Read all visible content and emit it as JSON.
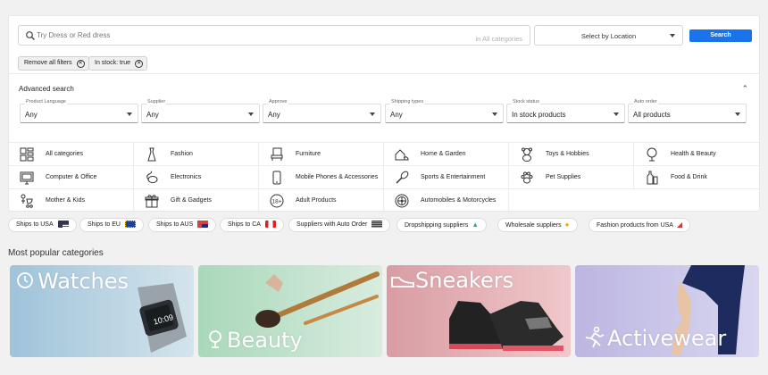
{
  "search": {
    "placeholder": "Try Dress or Red dress",
    "scope": "in All categories",
    "location_placeholder": "Select by Location",
    "button_label": "Search"
  },
  "active_filters": {
    "remove_all_label": "Remove all filters",
    "chips": [
      "In stock: true"
    ]
  },
  "advanced_search": {
    "title": "Advanced search",
    "filters": [
      {
        "label": "Product Language",
        "value": "Any"
      },
      {
        "label": "Supplier",
        "value": "Any"
      },
      {
        "label": "Approve",
        "value": "Any"
      },
      {
        "label": "Shipping types",
        "value": "Any"
      },
      {
        "label": "Stock status",
        "value": "In stock products"
      },
      {
        "label": "Auto order",
        "value": "All products"
      }
    ]
  },
  "categories": [
    {
      "name": "All categories",
      "icon": "grid-icon"
    },
    {
      "name": "Fashion",
      "icon": "dress-icon"
    },
    {
      "name": "Furniture",
      "icon": "chair-icon"
    },
    {
      "name": "Home & Garden",
      "icon": "house-icon"
    },
    {
      "name": "Toys & Hobbies",
      "icon": "teddy-bear-icon"
    },
    {
      "name": "Health & Beauty",
      "icon": "mirror-icon"
    },
    {
      "name": "Computer & Office",
      "icon": "monitor-icon"
    },
    {
      "name": "Electronics",
      "icon": "mouse-icon"
    },
    {
      "name": "Mobile Phones & Accessories",
      "icon": "phone-icon"
    },
    {
      "name": "Sports & Entertainment",
      "icon": "racket-icon"
    },
    {
      "name": "Pet Supplies",
      "icon": "paw-icon"
    },
    {
      "name": "Food & Drink",
      "icon": "bottle-icon"
    },
    {
      "name": "Mother & Kids",
      "icon": "stroller-icon"
    },
    {
      "name": "Gift & Gadgets",
      "icon": "gift-icon"
    },
    {
      "name": "Adult Products",
      "icon": "eighteen-plus-icon"
    },
    {
      "name": "Automobiles & Motorcycles",
      "icon": "wheel-icon"
    }
  ],
  "quick_filters": [
    {
      "label": "Ships to USA",
      "icon": "usa-flag-icon"
    },
    {
      "label": "Ships to EU",
      "icon": "eu-flag-icon"
    },
    {
      "label": "Ships to AUS",
      "icon": "australia-flag-icon"
    },
    {
      "label": "Ships to CA",
      "icon": "canada-flag-icon"
    },
    {
      "label": "Suppliers with Auto Order",
      "icon": "auto-order-icon"
    },
    {
      "label": "Dropshipping suppliers",
      "icon": "dropship-icon"
    },
    {
      "label": "Wholesale suppliers",
      "icon": "wholesale-icon"
    },
    {
      "label": "Fashion products from USA",
      "icon": "shoe-icon"
    }
  ],
  "popular": {
    "title": "Most popular categories",
    "cards": [
      {
        "label": "Watches",
        "icon": "watch-icon"
      },
      {
        "label": "Beauty",
        "icon": "mirror-icon"
      },
      {
        "label": "Sneakers",
        "icon": "sneaker-icon"
      },
      {
        "label": "Activewear",
        "icon": "runner-icon"
      }
    ]
  },
  "colors": {
    "accent": "#1a73e8",
    "watches_bg": "#a9c8da",
    "beauty_bg": "#b7dcc4",
    "sneakers_bg": "#e2a4a8",
    "activewear_bg": "#c4c0e6"
  }
}
